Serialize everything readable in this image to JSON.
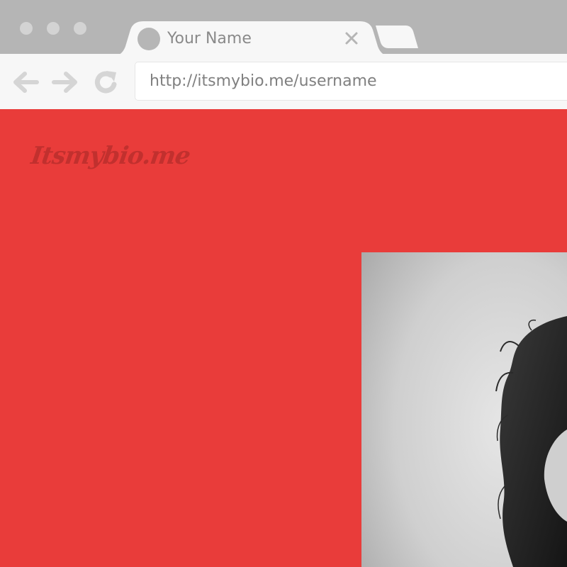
{
  "browser": {
    "tab": {
      "title": "Your Name",
      "favicon_icon": "circle-favicon-icon",
      "close_icon": "close-icon"
    },
    "toolbar": {
      "back_icon": "arrow-left-icon",
      "forward_icon": "arrow-right-icon",
      "reload_icon": "reload-icon",
      "url": "http://itsmybio.me/username"
    }
  },
  "page": {
    "background_color": "#e93c3a",
    "logo_text": "Itsmybio.me",
    "logo_color": "#c1302e",
    "photo": "profile-photo-black-and-white"
  }
}
